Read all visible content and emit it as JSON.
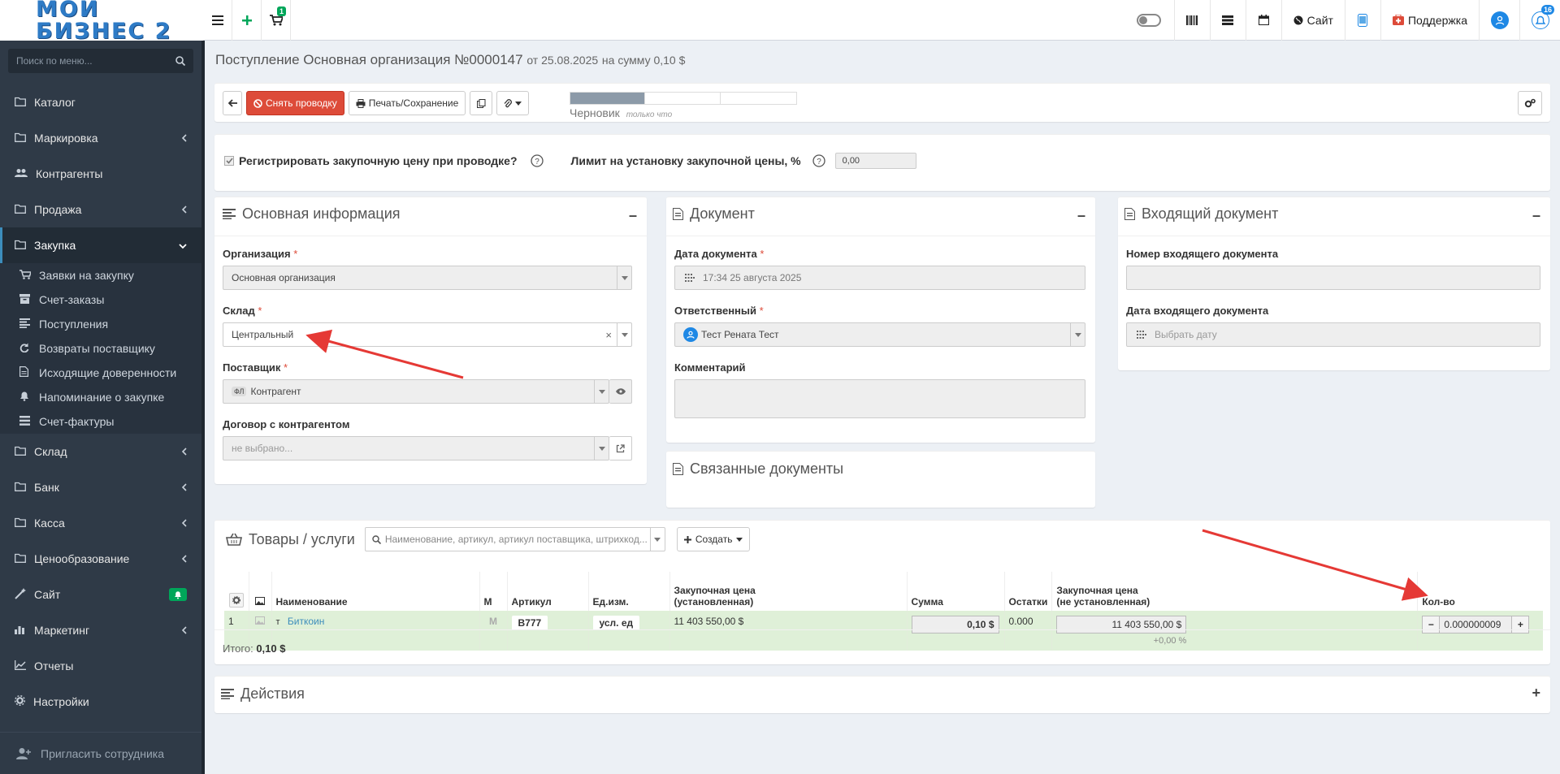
{
  "brand": {
    "logo_text": "МОЙ БИЗНЕС 2"
  },
  "topbar": {
    "cart_badge": "1",
    "site_label": "Сайт",
    "support_label": "Поддержка",
    "notif_badge": "16"
  },
  "sidebar": {
    "search_placeholder": "Поиск по меню...",
    "items": [
      {
        "label": "Каталог",
        "icon": "folder-icon",
        "arrow": false
      },
      {
        "label": "Маркировка",
        "icon": "folder-icon",
        "arrow": true
      },
      {
        "label": "Контрагенты",
        "icon": "users-icon",
        "arrow": false
      },
      {
        "label": "Продажа",
        "icon": "folder-icon",
        "arrow": true
      },
      {
        "label": "Закупка",
        "icon": "folder-icon",
        "arrow": true,
        "active": true
      }
    ],
    "sub_items": [
      {
        "label": "Заявки на закупку",
        "icon": "cart-icon"
      },
      {
        "label": "Счет-заказы",
        "icon": "archive-icon"
      },
      {
        "label": "Поступления",
        "icon": "lines-icon"
      },
      {
        "label": "Возвраты поставщику",
        "icon": "refresh-icon"
      },
      {
        "label": "Исходящие доверенности",
        "icon": "document-icon"
      },
      {
        "label": "Напоминание о закупке",
        "icon": "bell-icon"
      },
      {
        "label": "Счет-фактуры",
        "icon": "list-icon"
      }
    ],
    "items2": [
      {
        "label": "Склад",
        "icon": "folder-icon",
        "arrow": true
      },
      {
        "label": "Банк",
        "icon": "folder-icon",
        "arrow": true
      },
      {
        "label": "Касса",
        "icon": "folder-icon",
        "arrow": true
      },
      {
        "label": "Ценообразование",
        "icon": "folder-icon",
        "arrow": true
      },
      {
        "label": "Сайт",
        "icon": "magic-icon",
        "arrow": false,
        "bell": true
      },
      {
        "label": "Маркетинг",
        "icon": "chart-icon",
        "arrow": true
      },
      {
        "label": "Отчеты",
        "icon": "line-chart-icon",
        "arrow": false
      },
      {
        "label": "Настройки",
        "icon": "gear-icon",
        "arrow": false
      }
    ],
    "invite_label": "Пригласить сотрудника"
  },
  "page": {
    "title": "Поступление Основная организация №0000147",
    "title_date": "от 25.08.2025",
    "title_sum": "на сумму 0,10 $"
  },
  "toolbar": {
    "unpost_label": "Снять проводку",
    "print_label": "Печать/Сохранение",
    "status": "Черновик",
    "status_time": "только что",
    "progress": 0.33
  },
  "settings_row": {
    "register_label": "Регистрировать закупочную цену при проводке?",
    "register_checked": true,
    "limit_label": "Лимит на установку закупочной цены, %",
    "limit_value": "0,00"
  },
  "basic": {
    "title": "Основная информация",
    "org_label": "Организация",
    "org_value": "Основная организация",
    "warehouse_label": "Склад",
    "warehouse_value": "Центральный",
    "supplier_label": "Поставщик",
    "supplier_prefix": "ФЛ",
    "supplier_value": "Контрагент",
    "contract_label": "Договор с контрагентом",
    "contract_value": "не выбрано..."
  },
  "document": {
    "title": "Документ",
    "date_label": "Дата документа",
    "date_value": "17:34 25 августа 2025",
    "resp_label": "Ответственный",
    "resp_value": "Тест Рената Тест",
    "comment_label": "Комментарий",
    "related_title": "Связанные документы"
  },
  "incoming": {
    "title": "Входящий документ",
    "number_label": "Номер входящего документа",
    "date_label": "Дата входящего документа",
    "date_placeholder": "Выбрать дату"
  },
  "goods": {
    "title": "Товары / услуги",
    "search_placeholder": "Наименование, артикул, артикул поставщика, штрихкод...",
    "create_label": "Создать",
    "columns": {
      "name": "Наименование",
      "m": "М",
      "article": "Артикул",
      "unit": "Ед.изм.",
      "price_set_1": "Закупочная цена",
      "price_set_2": "(установленная)",
      "sum": "Сумма",
      "stock": "Остатки",
      "price_unset_1": "Закупочная цена",
      "price_unset_2": "(не установленная)",
      "qty": "Кол-во"
    },
    "rows": [
      {
        "num": "1",
        "type": "т",
        "name": "Биткоин",
        "m": "М",
        "article": "B777",
        "unit": "усл. ед",
        "price_set": "11 403 550,00 $",
        "sum": "0,10 $",
        "stock": "0.000",
        "price_unset": "11 403 550,00 $",
        "markup": "+0,00 %",
        "qty": "0.000000009"
      }
    ],
    "total_label": "Итого:",
    "total_value": "0,10 $"
  },
  "actions": {
    "title": "Действия"
  }
}
